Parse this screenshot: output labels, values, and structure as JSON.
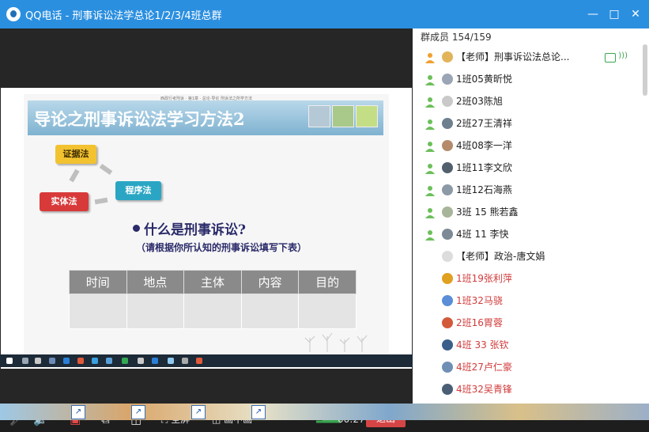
{
  "window": {
    "title": "QQ电话 - 刑事诉讼法学总论1/2/3/4班总群"
  },
  "slide": {
    "caption": "西政行考刑诉 · 第1章 · 总论·导论 刑诉法之所学方法",
    "title": "导论之刑事诉讼法学习方法2",
    "keys": {
      "k1": "证据法",
      "k2": "程序法",
      "k3": "实体法"
    },
    "question": "什么是刑事诉讼?",
    "hint": "（请根据你所认知的刑事诉讼填写下表）",
    "table_headers": [
      "时间",
      "地点",
      "主体",
      "内容",
      "目的"
    ]
  },
  "controls": {
    "fullscreen": "全屏",
    "pip": "画中画",
    "timer": "00:27",
    "hangup": "退出"
  },
  "members": {
    "count_label": "群成员 154/159",
    "list": [
      {
        "name": "【老师】刑事诉讼法总论...",
        "red": false,
        "speaking": true
      },
      {
        "name": "1班05黄昕悦",
        "red": false
      },
      {
        "name": "2班03陈旭",
        "red": false
      },
      {
        "name": "2班27王清祥",
        "red": false
      },
      {
        "name": "4班08李一洋",
        "red": false
      },
      {
        "name": "1班11李文欣",
        "red": false
      },
      {
        "name": "1班12石海燕",
        "red": false
      },
      {
        "name": "3班 15 熊若鑫",
        "red": false
      },
      {
        "name": "4班 11 李快",
        "red": false
      },
      {
        "name": "【老师】政治-唐文娟",
        "red": false
      },
      {
        "name": "1班19张利萍",
        "red": true
      },
      {
        "name": "1班32马骁",
        "red": true
      },
      {
        "name": "2班16胃蓉",
        "red": true
      },
      {
        "name": "4班 33 张钦",
        "red": true
      },
      {
        "name": "4班27卢仁豪",
        "red": true
      },
      {
        "name": "4班32吴青锋",
        "red": true
      }
    ]
  },
  "colors": {
    "titlebar": "#2b8fe0",
    "hangup": "#d64545",
    "red_name": "#d23b3b",
    "active_green": "#3ba550"
  }
}
